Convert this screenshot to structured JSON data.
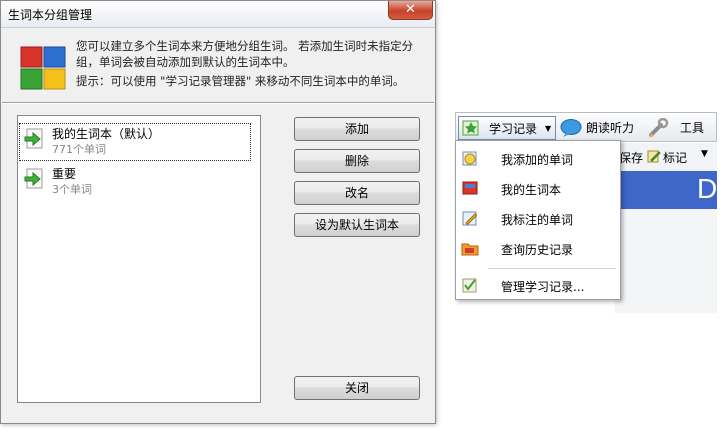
{
  "dialog": {
    "title": "生词本分组管理",
    "close_glyph": "✕",
    "description": "您可以建立多个生词本来方便地分组生词。 若添加生词时未指定分组，单词会被自动添加到默认的生词本中。",
    "hint": "提示：可以使用 \"学习记录管理器\" 来移动不同生词本中的单词。",
    "wordbooks": [
      {
        "name": "我的生词本（默认）",
        "count": "771个单词",
        "selected": true
      },
      {
        "name": "重要",
        "count": "3个单词",
        "selected": false
      }
    ],
    "buttons": {
      "add": "添加",
      "delete": "删除",
      "rename": "改名",
      "set_default": "设为默认生词本",
      "close": "关闭"
    }
  },
  "toolbar": {
    "study_record": "学习记录",
    "read_listen": "朗读听力",
    "tools": "工具",
    "save_partial": "保存",
    "mark": "标记",
    "blue_letter": "D"
  },
  "menu": {
    "items": [
      {
        "label": "我添加的单词",
        "icon": "smiley-book-icon"
      },
      {
        "label": "我的生词本",
        "icon": "red-book-icon"
      },
      {
        "label": "我标注的单词",
        "icon": "pencil-book-icon"
      },
      {
        "label": "查询历史记录",
        "icon": "orange-folder-icon"
      },
      {
        "label": "管理学习记录...",
        "icon": "checkmark-icon"
      }
    ]
  },
  "colors": {
    "dialog_bg": "#f0f0f0",
    "close_red": "#c7432a",
    "accent_blue": "#3f66c9"
  }
}
